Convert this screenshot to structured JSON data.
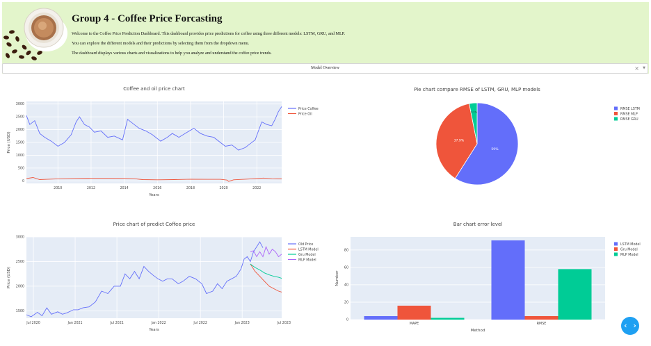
{
  "header": {
    "title": "Group 4 - Coffee Price Forcasting",
    "lines": [
      "Welcome to the Coffee Price Prediction Dashboard. This dashboard provides price predictions for coffee using three different models: LSTM, GRU, and MLP.",
      "You can explore the different models and their predictions by selecting them from the dropdown menu.",
      "The dashboard displays various charts and visualizations to help you analyze and understand the coffee price trends."
    ],
    "logo_icon": "coffee-cup-logo"
  },
  "dropdown": {
    "value": "Model Overview",
    "clear_glyph": "×",
    "arrow_glyph": "▼"
  },
  "fab": {
    "icon": "code-arrows-icon",
    "glyph": "‹ ›",
    "color": "#1fa0f2"
  },
  "colors": {
    "blue": "#636efa",
    "red": "#ef553b",
    "green": "#00cc96",
    "purple": "#ab63fa",
    "plot_bg": "#e5ecf6",
    "header_bg": "#e3f5cb"
  },
  "chart_data": [
    {
      "type": "line",
      "title": "Coffee and oil price chart",
      "xlabel": "Years",
      "ylabel": "Price (USD)",
      "xlim": [
        2008.1,
        2023.5
      ],
      "ylim": [
        -100,
        3100
      ],
      "x_ticks": [
        2010,
        2012,
        2014,
        2016,
        2018,
        2020,
        2022
      ],
      "y_ticks": [
        0,
        500,
        1000,
        1500,
        2000,
        2500,
        3000
      ],
      "grid": true,
      "legend_position": "top-right",
      "series": [
        {
          "name": "Price Coffee",
          "color": "#636efa",
          "x": [
            2008.1,
            2008.3,
            2008.6,
            2008.9,
            2009.2,
            2009.6,
            2010.0,
            2010.4,
            2010.8,
            2011.1,
            2011.3,
            2011.6,
            2011.9,
            2012.2,
            2012.6,
            2013.0,
            2013.4,
            2013.9,
            2014.2,
            2014.6,
            2014.9,
            2015.3,
            2015.7,
            2016.2,
            2016.6,
            2016.9,
            2017.3,
            2017.8,
            2018.2,
            2018.6,
            2019.0,
            2019.4,
            2019.8,
            2020.1,
            2020.5,
            2020.9,
            2021.3,
            2021.6,
            2021.9,
            2022.1,
            2022.3,
            2022.6,
            2022.9,
            2023.1,
            2023.3,
            2023.5
          ],
          "y": [
            2550,
            2200,
            2350,
            1850,
            1700,
            1550,
            1350,
            1500,
            1800,
            2300,
            2500,
            2200,
            2100,
            1900,
            1950,
            1700,
            1750,
            1600,
            2400,
            2200,
            2050,
            1950,
            1800,
            1550,
            1700,
            1850,
            1700,
            1900,
            2050,
            1850,
            1750,
            1700,
            1500,
            1350,
            1400,
            1200,
            1300,
            1450,
            1600,
            1950,
            2300,
            2200,
            2150,
            2400,
            2700,
            2900
          ]
        },
        {
          "name": "Price Oil",
          "color": "#ef553b",
          "x": [
            2008.1,
            2008.5,
            2008.9,
            2009.3,
            2010.0,
            2011.0,
            2012.0,
            2013.0,
            2014.0,
            2014.6,
            2015.1,
            2016.0,
            2017.0,
            2018.0,
            2019.0,
            2019.8,
            2020.2,
            2020.3,
            2020.6,
            2021.0,
            2021.5,
            2022.0,
            2022.4,
            2022.9,
            2023.5
          ],
          "y": [
            90,
            130,
            50,
            60,
            80,
            95,
            100,
            100,
            98,
            85,
            50,
            40,
            50,
            65,
            60,
            60,
            30,
            -20,
            40,
            55,
            70,
            90,
            110,
            85,
            75
          ]
        }
      ]
    },
    {
      "type": "pie",
      "title": "Pie chart compare RMSE of LSTM, GRU, MLP models",
      "legend_position": "top-right",
      "labels": [
        "RMSE LSTM",
        "RMSE MLP",
        "RMSE GRU"
      ],
      "values": [
        59,
        37.9,
        3.1
      ],
      "text": [
        "59%",
        "37.9%",
        "3.1%"
      ],
      "colors": [
        "#636efa",
        "#ef553b",
        "#00cc96"
      ]
    },
    {
      "type": "line",
      "title": "Price chart of predict Coffee price",
      "xlabel": "Years",
      "ylabel": "Price (USD)",
      "x_ticks": [
        "Jul 2020",
        "Jan 2021",
        "Jul 2021",
        "Jan 2022",
        "Jul 2022",
        "Jan 2023",
        "Jul 2023"
      ],
      "y_ticks": [
        1500,
        2000,
        2500,
        3000
      ],
      "ylim": [
        1350,
        3000
      ],
      "grid": true,
      "legend_position": "top-right",
      "series": [
        {
          "name": "Old Price",
          "color": "#636efa",
          "x": [
            0,
            0.3,
            0.7,
            1.0,
            1.3,
            1.6,
            2.0,
            2.3,
            2.6,
            3.0,
            3.3,
            3.6,
            4.0,
            4.4,
            4.8,
            5.2,
            5.6,
            6.0,
            6.3,
            6.6,
            6.9,
            7.2,
            7.5,
            7.8,
            8.1,
            8.4,
            8.7,
            9.0,
            9.3,
            9.7,
            10.0,
            10.4,
            10.8,
            11.2,
            11.5,
            11.9,
            12.2,
            12.5,
            12.8,
            13.1,
            13.4,
            13.7,
            13.9,
            14.1,
            14.3,
            14.5,
            14.7,
            14.9,
            15.1
          ],
          "y": [
            1420,
            1380,
            1470,
            1400,
            1560,
            1430,
            1480,
            1430,
            1460,
            1520,
            1520,
            1560,
            1580,
            1680,
            1900,
            1850,
            2000,
            2000,
            2250,
            2150,
            2300,
            2150,
            2400,
            2300,
            2220,
            2150,
            2100,
            2150,
            2150,
            2050,
            2100,
            2200,
            2150,
            2050,
            1850,
            1900,
            2050,
            1950,
            2100,
            2150,
            2200,
            2350,
            2550,
            2600,
            2500,
            2700,
            2800,
            2900,
            2780
          ],
          "x_note": "months since Jun 2020"
        },
        {
          "name": "LSTM Model",
          "color": "#ef553b",
          "x": [
            14.3,
            14.6,
            14.9,
            15.2,
            15.5,
            15.8,
            16.1,
            16.3
          ],
          "y": [
            2450,
            2300,
            2200,
            2100,
            2000,
            1950,
            1900,
            1880
          ]
        },
        {
          "name": "Gru Model",
          "color": "#00cc96",
          "x": [
            14.3,
            14.6,
            14.9,
            15.2,
            15.5,
            15.8,
            16.1,
            16.3
          ],
          "y": [
            2450,
            2380,
            2330,
            2270,
            2230,
            2200,
            2180,
            2160
          ]
        },
        {
          "name": "MLP Model",
          "color": "#ab63fa",
          "x": [
            14.3,
            14.5,
            14.7,
            14.9,
            15.1,
            15.3,
            15.5,
            15.7,
            15.9,
            16.1,
            16.3
          ],
          "y": [
            2700,
            2720,
            2600,
            2700,
            2600,
            2800,
            2650,
            2750,
            2700,
            2600,
            2650
          ]
        }
      ]
    },
    {
      "type": "bar",
      "title": "Bar chart error level",
      "xlabel": "Method",
      "ylabel": "Number",
      "categories": [
        "MAPE",
        "RMSE"
      ],
      "ylim": [
        0,
        95
      ],
      "y_ticks": [
        0,
        20,
        40,
        60,
        80
      ],
      "grid": true,
      "legend_position": "top-right",
      "series": [
        {
          "name": "LSTM Model",
          "color": "#636efa",
          "values": [
            4,
            91
          ]
        },
        {
          "name": "Gru Model",
          "color": "#ef553b",
          "values": [
            16,
            4
          ]
        },
        {
          "name": "MLP Model",
          "color": "#00cc96",
          "values": [
            2,
            58
          ]
        }
      ]
    }
  ]
}
